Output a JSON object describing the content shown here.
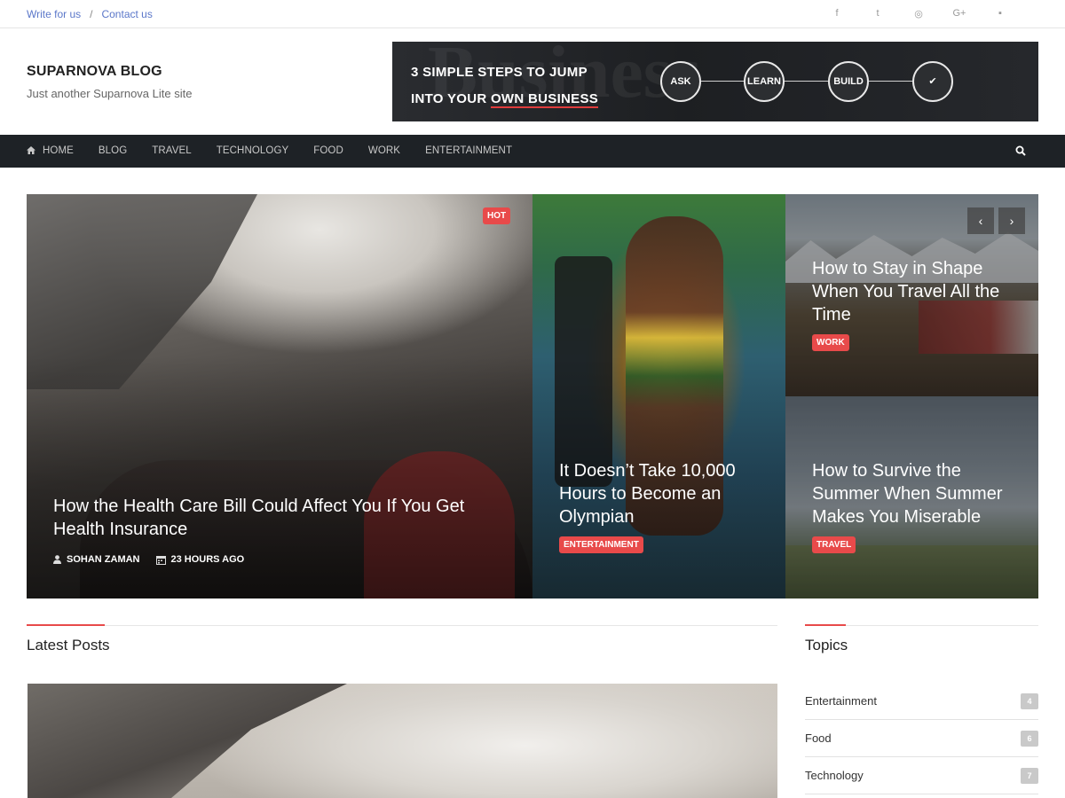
{
  "topbar": {
    "links": [
      "Write for us",
      "Contact us"
    ],
    "separator": "/",
    "social": [
      {
        "icon": "facebook-icon",
        "glyph": "f"
      },
      {
        "icon": "twitter-icon",
        "glyph": "t"
      },
      {
        "icon": "instagram-icon",
        "glyph": "◎"
      },
      {
        "icon": "google-plus-icon",
        "glyph": "G+"
      },
      {
        "icon": "flickr-icon",
        "glyph": "▪"
      }
    ]
  },
  "site": {
    "title": "SUPARNOVA BLOG",
    "tagline": "Just another Suparnova Lite site"
  },
  "banner": {
    "line1": "3 SIMPLE STEPS TO JUMP",
    "line2_prefix": "INTO YOUR",
    "line2_accent": "OWN BUSINESS",
    "steps": [
      "ASK",
      "LEARN",
      "BUILD",
      "✔"
    ],
    "accent_color": "#e03c3c"
  },
  "nav": {
    "items": [
      "HOME",
      "BLOG",
      "TRAVEL",
      "TECHNOLOGY",
      "FOOD",
      "WORK",
      "ENTERTAINMENT"
    ]
  },
  "featured": {
    "main": {
      "badge": "HOT",
      "title": "How the Health Care Bill Could Affect You If You Get Health Insurance",
      "author": "SOHAN ZAMAN",
      "time": "23 HOURS AGO"
    },
    "second": {
      "title": "It Doesn’t Take 10,000 Hours to Become an Olympian",
      "category": "ENTERTAINMENT"
    },
    "third": {
      "title": "How to Stay in Shape When You Travel All the Time",
      "category": "WORK"
    },
    "fourth": {
      "title": "How to Survive the Summer When Summer Makes You Miserable",
      "category": "TRAVEL"
    },
    "arrows": {
      "prev": "‹",
      "next": "›"
    }
  },
  "latest": {
    "title": "Latest Posts"
  },
  "topics": {
    "title": "Topics",
    "items": [
      {
        "name": "Entertainment",
        "count": "4"
      },
      {
        "name": "Food",
        "count": "6"
      },
      {
        "name": "Technology",
        "count": "7"
      }
    ]
  },
  "colors": {
    "accent": "#e84a4a",
    "nav_bg": "#1e2226",
    "link": "#5b77c9"
  }
}
